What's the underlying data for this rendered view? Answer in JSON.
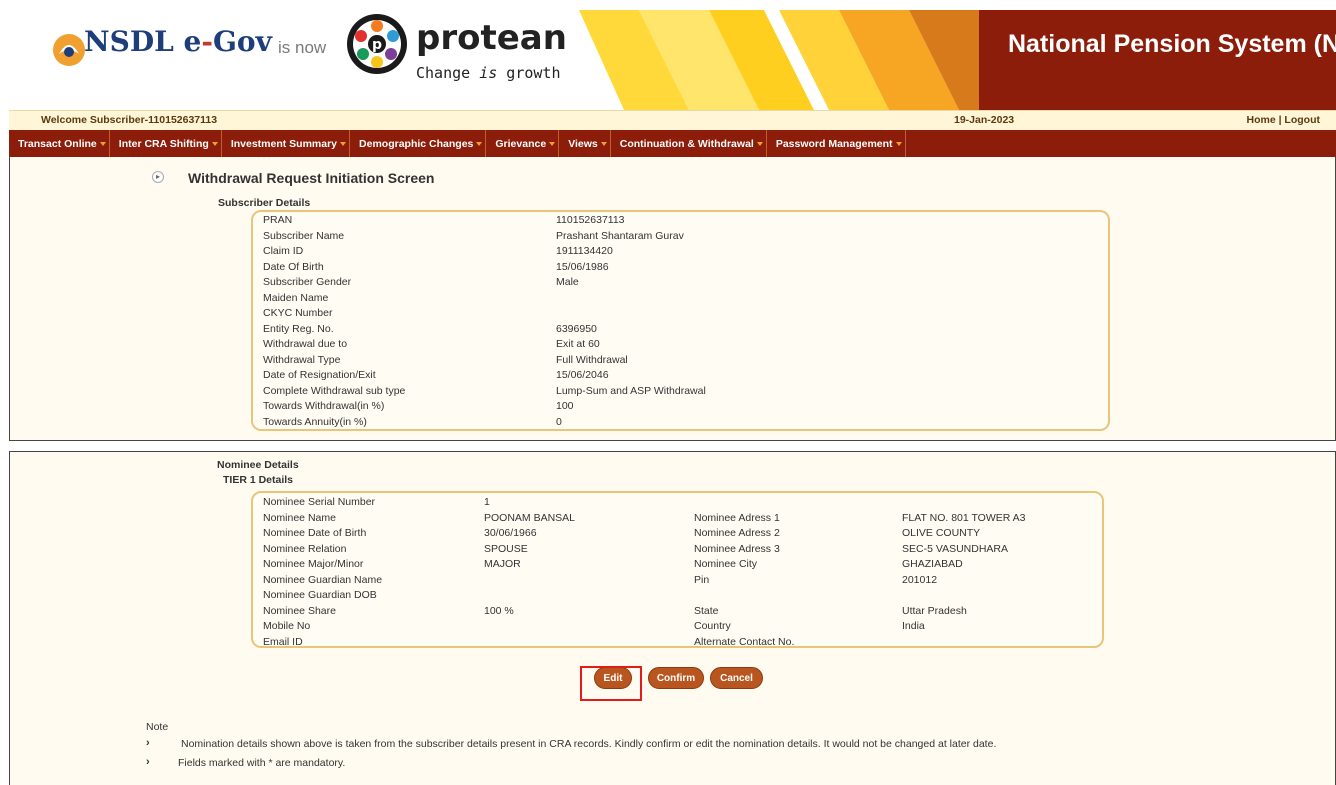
{
  "header": {
    "nsdl_brand_main": "NSDL e",
    "nsdl_brand_dash": "-",
    "nsdl_brand_end": "Gov",
    "is_now": "is now",
    "protean": "protean",
    "tagline_a": "Change ",
    "tagline_b": "is",
    "tagline_c": " growth",
    "system_title": "National Pension System (NPS)"
  },
  "welcome_bar": {
    "welcome": "Welcome Subscriber-110152637113",
    "date": "19-Jan-2023",
    "home_logout": "Home | Logout"
  },
  "nav": {
    "items": [
      {
        "label": "Transact Online"
      },
      {
        "label": "Inter CRA Shifting"
      },
      {
        "label": "Investment Summary"
      },
      {
        "label": "Demographic Changes"
      },
      {
        "label": "Grievance"
      },
      {
        "label": "Views"
      },
      {
        "label": "Continuation & Withdrawal"
      },
      {
        "label": "Password Management"
      }
    ]
  },
  "page": {
    "title": "Withdrawal Request Initiation Screen",
    "subscriber_details_label": "Subscriber Details"
  },
  "subscriber": {
    "rows": [
      {
        "label": "PRAN",
        "value": "110152637113"
      },
      {
        "label": "Subscriber Name",
        "value": "Prashant Shantaram Gurav"
      },
      {
        "label": "Claim ID",
        "value": "1911134420"
      },
      {
        "label": "Date Of Birth",
        "value": "15/06/1986"
      },
      {
        "label": "Subscriber Gender",
        "value": "Male"
      },
      {
        "label": "Maiden Name",
        "value": ""
      },
      {
        "label": "CKYC Number",
        "value": ""
      },
      {
        "label": "Entity Reg. No.",
        "value": "6396950"
      },
      {
        "label": "Withdrawal due to",
        "value": "Exit at 60"
      },
      {
        "label": "Withdrawal Type",
        "value": "Full Withdrawal"
      },
      {
        "label": "Date of Resignation/Exit",
        "value": "15/06/2046"
      },
      {
        "label": "Complete Withdrawal sub type",
        "value": "Lump-Sum and ASP Withdrawal"
      },
      {
        "label": "Towards Withdrawal(in %)",
        "value": "100"
      },
      {
        "label": "Towards Annuity(in %)",
        "value": "0"
      }
    ]
  },
  "nominee": {
    "section_label": "Nominee Details",
    "tier_label": "TIER 1 Details",
    "left_rows": [
      {
        "label": "Nominee Serial Number",
        "value": "1"
      },
      {
        "label": "Nominee Name",
        "value": "POONAM BANSAL"
      },
      {
        "label": "Nominee Date of Birth",
        "value": "30/06/1966"
      },
      {
        "label": "Nominee Relation",
        "value": "SPOUSE"
      },
      {
        "label": "Nominee Major/Minor",
        "value": "MAJOR"
      },
      {
        "label": "Nominee Guardian Name",
        "value": ""
      },
      {
        "label": "Nominee Guardian DOB",
        "value": ""
      },
      {
        "label": "Nominee Share",
        "value": "100 %"
      },
      {
        "label": "Mobile No",
        "value": ""
      },
      {
        "label": "Email ID",
        "value": ""
      }
    ],
    "right_rows": [
      {
        "label": "Nominee Adress 1",
        "value": "FLAT NO. 801 TOWER A3"
      },
      {
        "label": "Nominee Adress 2",
        "value": "OLIVE COUNTY"
      },
      {
        "label": "Nominee Adress 3",
        "value": "SEC-5 VASUNDHARA"
      },
      {
        "label": "Nominee City",
        "value": "GHAZIABAD"
      },
      {
        "label": "Pin",
        "value": "201012"
      },
      {
        "label": "State",
        "value": "Uttar Pradesh"
      },
      {
        "label": "Country",
        "value": "India"
      },
      {
        "label": "Alternate Contact No.",
        "value": ""
      }
    ]
  },
  "buttons": {
    "edit": "Edit",
    "confirm": "Confirm",
    "cancel": "Cancel"
  },
  "notes": {
    "label": "Note",
    "bullet": "›",
    "items": [
      "Nomination details shown above is taken from the subscriber details present in CRA records. Kindly confirm or edit the nomination details. It would not be changed at later date.",
      "Fields marked with * are mandatory."
    ]
  },
  "colors": {
    "brand_dark_red": "#8c1d0a",
    "accent_orange": "#f0a030",
    "button_orange": "#b9561f",
    "highlight_red": "#e21b1b",
    "box_border": "#e8c57a"
  }
}
